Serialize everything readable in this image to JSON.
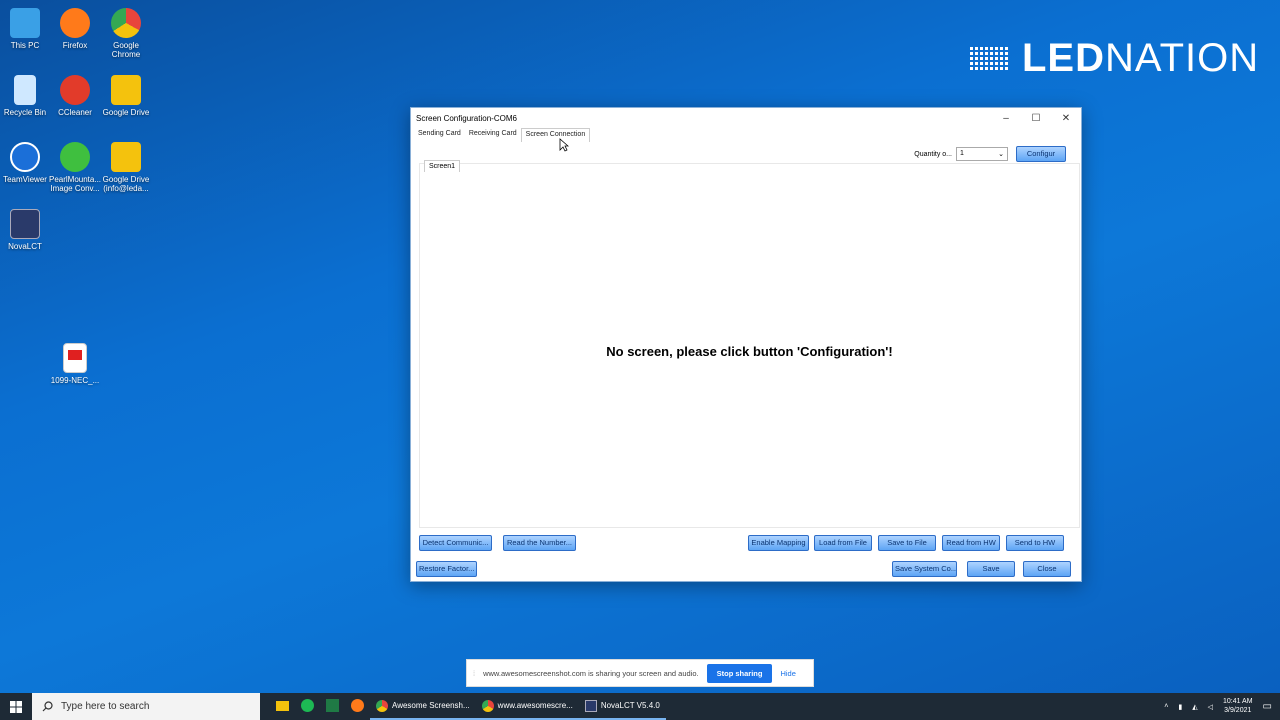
{
  "desktop": {
    "icons": [
      {
        "label": "This PC",
        "color": "#3aa0e6"
      },
      {
        "label": "Firefox",
        "color": "#ff7a1a"
      },
      {
        "label": "Google Chrome",
        "color": "#e8453c"
      },
      {
        "label": "Recycle Bin",
        "color": "#cfe8ff"
      },
      {
        "label": "CCleaner",
        "color": "#e23b2a"
      },
      {
        "label": "Google Drive",
        "color": "#f4c20d"
      },
      {
        "label": "TeamViewer",
        "color": "#1b6fd8"
      },
      {
        "label": "PearlMounta... Image Conv...",
        "color": "#3fbf3f"
      },
      {
        "label": "Google Drive (info@leda...",
        "color": "#f4c20d"
      },
      {
        "label": "NovaLCT",
        "color": "#2a3a6a"
      },
      {
        "label": "1099-NEC_...",
        "color": "#e02020"
      }
    ]
  },
  "brand": {
    "logo_bold": "LED",
    "logo_rest": "NATION"
  },
  "window": {
    "title": "Screen Configuration-COM6",
    "controls": {
      "minimize": "–",
      "maximize": "☐",
      "close": "✕"
    },
    "tabs": [
      "Sending Card",
      "Receiving Card",
      "Screen Connection"
    ],
    "active_tab": "Screen Connection",
    "quantity_label": "Quantity o...",
    "quantity_value": "1",
    "configure_button": "Configur",
    "subtab": "Screen1",
    "message": "No screen, please click button 'Configuration'!",
    "bottom_row1": [
      "Detect Communic...",
      "Read the Number...",
      "Enable Mapping",
      "Load from File",
      "Save to File",
      "Read from HW",
      "Send to HW"
    ],
    "bottom_row2": [
      "Restore Factor...",
      "Save System Co...",
      "Save",
      "Close"
    ]
  },
  "share_bar": {
    "text": "www.awesomescreenshot.com is sharing your screen and audio.",
    "stop": "Stop sharing",
    "hide": "Hide"
  },
  "taskbar": {
    "search_placeholder": "Type here to search",
    "items": [
      {
        "label": "Awesome Screensh...",
        "color": "#e8453c"
      },
      {
        "label": "www.awesomescre...",
        "color": "#e8453c"
      },
      {
        "label": "NovaLCT V5.4.0",
        "color": "#2a3a6a"
      }
    ],
    "time": "10:41 AM",
    "date": "3/9/2021"
  }
}
